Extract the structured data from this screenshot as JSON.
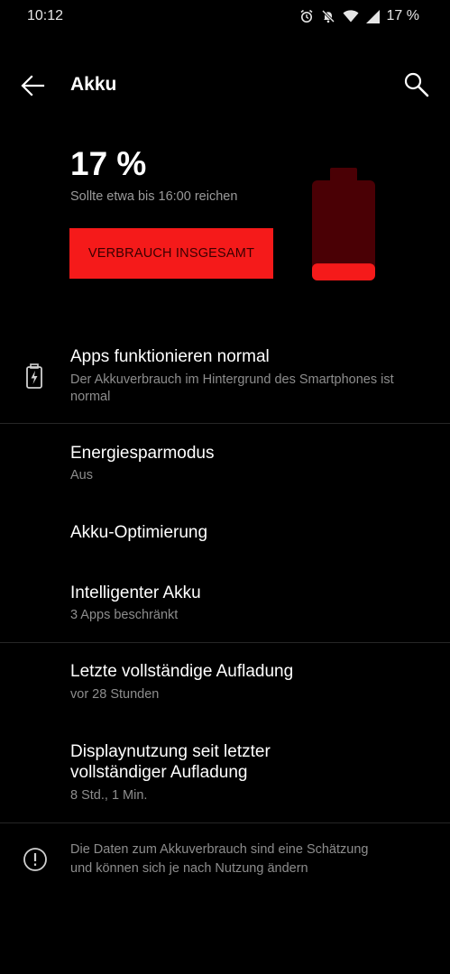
{
  "status_bar": {
    "time": "10:12",
    "battery_text": "17 %",
    "icons": [
      "alarm-icon",
      "notifications-off-icon",
      "wifi-icon",
      "signal-icon"
    ]
  },
  "app_bar": {
    "title": "Akku",
    "back_icon": "arrow-left-icon",
    "search_icon": "search-icon"
  },
  "battery": {
    "percent": "17 %",
    "level": 0.17,
    "estimate": "Sollte etwa bis 16:00 reichen",
    "usage_button": "VERBRAUCH INSGESAMT",
    "accent_color": "#f51a1a",
    "dim_color": "#4a0005"
  },
  "items": {
    "apps_status": {
      "title": "Apps funktionieren normal",
      "subtitle_line1": "Der Akkuverbrauch im Hintergrund des Smartphones ist",
      "subtitle_line2": "normal",
      "icon": "battery-charging-icon"
    },
    "power_saving": {
      "title": "Energiesparmodus",
      "subtitle": "Aus"
    },
    "optimization": {
      "title": "Akku-Optimierung"
    },
    "smart_battery": {
      "title": "Intelligenter Akku",
      "subtitle": "3 Apps beschränkt"
    },
    "last_charge": {
      "title": "Letzte vollständige Aufladung",
      "subtitle": "vor 28 Stunden"
    },
    "screen_usage": {
      "title_line1": "Displaynutzung seit letzter",
      "title_line2": "vollständiger Aufladung",
      "subtitle": "8 Std., 1 Min."
    }
  },
  "info": {
    "icon": "info-icon",
    "line1": "Die Daten zum Akkuverbrauch sind eine Schätzung",
    "line2": "und können sich je nach Nutzung ändern"
  }
}
